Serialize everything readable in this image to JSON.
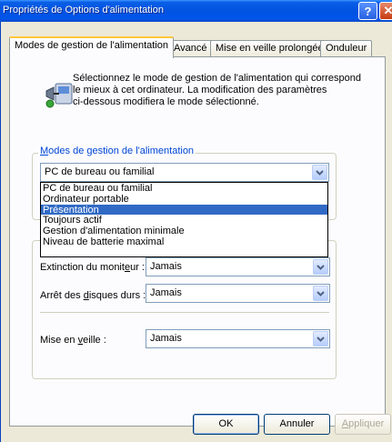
{
  "window": {
    "title": "Propriétés de Options d'alimentation",
    "help_label": "?",
    "close_label": "✕"
  },
  "tabs": [
    {
      "label": "Modes de gestion de l'alimentation"
    },
    {
      "label": "Avancé"
    },
    {
      "label": "Mise en veille prolongée"
    },
    {
      "label": "Onduleur"
    }
  ],
  "description": {
    "line1": "Sélectionnez le mode de gestion de l'alimentation qui correspond",
    "line2": "le mieux à cet ordinateur. La modification des paramètres",
    "line3": "ci-dessous modifiera le mode sélectionné."
  },
  "power_schemes": {
    "legend_prefix": "M",
    "legend_rest": "odes de gestion de l'alimentation",
    "selected_value": "PC de bureau ou familial",
    "options": [
      "PC de bureau ou familial",
      "Ordinateur portable",
      "Présentation",
      "Toujours actif",
      "Gestion d'alimentation minimale",
      "Niveau de batterie maximal"
    ],
    "highlighted_option": "Présentation"
  },
  "settings": {
    "monitor_label_pre": "Extinction du monit",
    "monitor_label_u": "e",
    "monitor_label_post": "ur :",
    "monitor_value": "Jamais",
    "disks_label_pre": "Arrêt des ",
    "disks_label_u": "d",
    "disks_label_post": "isques durs :",
    "disks_value": "Jamais",
    "standby_label_pre": "Mise en ",
    "standby_label_u": "v",
    "standby_label_post": "eille :",
    "standby_value": "Jamais"
  },
  "buttons": {
    "ok": "OK",
    "cancel": "Annuler",
    "apply_u": "A",
    "apply_rest": "ppliquer"
  }
}
